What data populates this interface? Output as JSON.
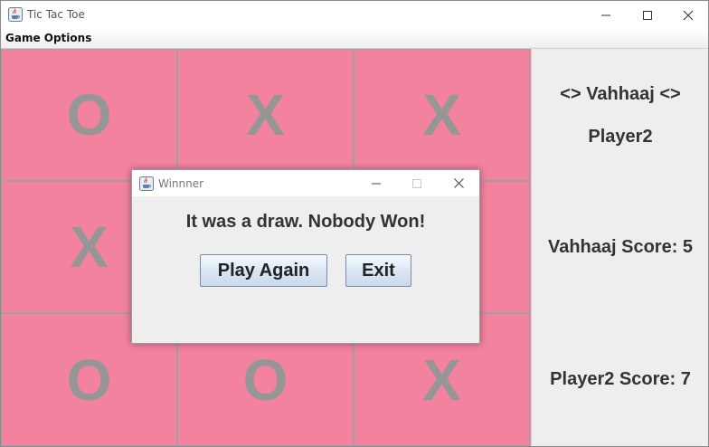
{
  "window": {
    "title": "Tic Tac Toe",
    "icon": "java-cup-icon"
  },
  "menu": {
    "items": [
      "Game Options"
    ]
  },
  "board": {
    "cells": [
      "O",
      "X",
      "X",
      "X",
      "",
      "",
      "O",
      "O",
      "X"
    ],
    "cell_color": "#f3829f",
    "mark_color": "#969696"
  },
  "side": {
    "current_player": "<> Vahhaaj <>",
    "opponent": "Player2",
    "score1": "Vahhaaj Score: 5",
    "score2": "Player2 Score: 7"
  },
  "dialog": {
    "title": "Winnner",
    "message": "It was a draw. Nobody Won!",
    "play_again": "Play Again",
    "exit": "Exit"
  }
}
